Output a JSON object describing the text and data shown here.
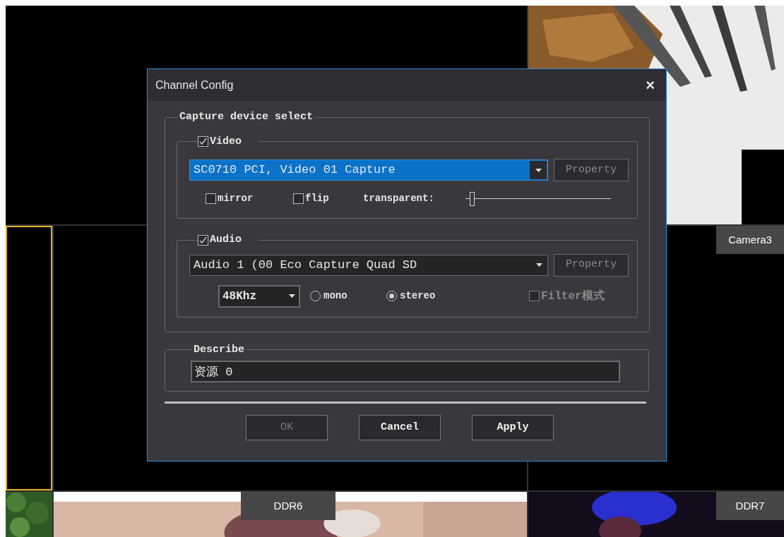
{
  "video_wall": {
    "cells": [
      {
        "kind": "empty",
        "selected": false
      },
      {
        "kind": "picture",
        "selected": false
      },
      {
        "kind": "empty",
        "selected": true
      },
      {
        "kind": "empty",
        "selected": false
      },
      {
        "kind": "empty",
        "label": "Camera3",
        "selected": false
      },
      {
        "kind": "picture",
        "selected": false
      },
      {
        "kind": "picture",
        "label": "DDR6",
        "selected": false
      },
      {
        "kind": "picture",
        "label": "DDR7",
        "selected": false
      }
    ]
  },
  "dialog": {
    "title": "Channel Config",
    "close": "×",
    "capture_group": {
      "title": "Capture device select",
      "video": {
        "label": "Video",
        "checked": true,
        "device": "SC0710 PCI, Video 01 Capture",
        "device_selected": true,
        "property_button": {
          "label": "Property",
          "disabled": true
        },
        "options": [
          {
            "label": "mirror",
            "checked": false
          },
          {
            "label": "flip",
            "checked": false
          }
        ],
        "transparent": {
          "label": "transparent:",
          "level": 0.03
        }
      },
      "audio": {
        "label": "Audio",
        "checked": true,
        "device": "Audio 1 (00 Eco Capture Quad SD",
        "property_button": {
          "label": "Property",
          "disabled": true
        },
        "sample_rate": "48Khz",
        "channels": [
          {
            "label": "mono",
            "selected": false
          },
          {
            "label": "stereo",
            "selected": true
          }
        ],
        "filter": {
          "label": "Filter模式",
          "checked": false,
          "disabled": true
        }
      }
    },
    "describe": {
      "title": "Describe",
      "value": "资源 0"
    },
    "buttons": [
      {
        "label": "OK",
        "disabled": true
      },
      {
        "label": "Cancel",
        "disabled": false
      },
      {
        "label": "Apply",
        "disabled": false
      }
    ]
  }
}
